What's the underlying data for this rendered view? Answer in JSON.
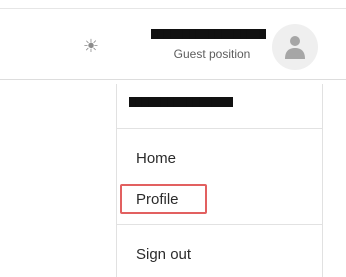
{
  "header": {
    "theme_toggle_glyph": "☀",
    "user_name": "████████████████████",
    "user_role": "Guest position",
    "avatar_icon": "user-icon",
    "theme_icon": "sun-icon",
    "colors": {
      "avatar_bg": "#efefef",
      "avatar_fg": "#a6a6a6",
      "redaction": "#111111",
      "icon_gray": "#8c8c8c"
    }
  },
  "menu": {
    "user_name": "█████████████",
    "items": [
      {
        "label": "Home"
      },
      {
        "label": "Profile",
        "highlighted": true
      },
      {
        "label": "Sign out"
      }
    ],
    "colors": {
      "highlight_box": "#e26060",
      "text": "#2b2b2b",
      "divider": "#e2e2e2"
    }
  }
}
